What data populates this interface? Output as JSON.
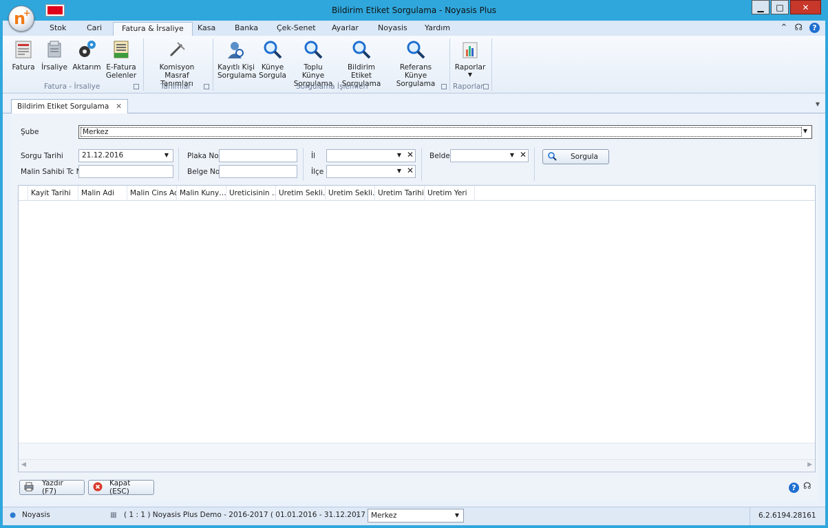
{
  "window": {
    "title": "Bildirim Etiket Sorgulama - Noyasis Plus",
    "minimize_glyph": "▁",
    "maximize_glyph": "□",
    "close_glyph": "✕"
  },
  "menu": {
    "tabs": [
      "Stok",
      "Cari",
      "Fatura & İrsaliye",
      "Kasa",
      "Banka",
      "Çek-Senet",
      "Ayarlar",
      "Noyasis",
      "Yardım"
    ],
    "active_tab": "Fatura & İrsaliye"
  },
  "ribbon": {
    "groups": [
      {
        "label": "Fatura - İrsaliye",
        "buttons": [
          "Fatura",
          "İrsaliye",
          "Aktarım",
          "E-Fatura Gelenler"
        ]
      },
      {
        "label": "Tanımlar",
        "buttons": [
          "Komisyon Masraf Tanımları"
        ]
      },
      {
        "label": "Sorgulama İşlemleri",
        "buttons": [
          "Kayıtlı Kişi Sorgulama",
          "Künye Sorgula",
          "Toplu Künye Sorgulama",
          "Bildirim Etiket Sorgulama",
          "Referans Künye Sorgulama"
        ]
      },
      {
        "label": "Raporlar",
        "buttons": [
          "Raporlar"
        ]
      }
    ]
  },
  "doc_tab": {
    "label": "Bildirim Etiket Sorgulama",
    "close": "✕"
  },
  "form": {
    "sube_label": "Şube",
    "sube_value": "Merkez",
    "sorgu_tarihi_label": "Sorgu Tarihi",
    "sorgu_tarihi_value": "21.12.2016",
    "malin_sahibi_label": "Malin Sahibi Tc No",
    "malin_sahibi_value": "",
    "plaka_label": "Plaka No",
    "plaka_value": "",
    "belge_label": "Belge No",
    "belge_value": "",
    "il_label": "İl",
    "il_value": "",
    "ilce_label": "İlçe",
    "ilce_value": "",
    "belde_label": "Belde",
    "belde_value": "",
    "sorgula_label": "Sorgula"
  },
  "grid": {
    "columns": [
      "Kayit Tarihi",
      "Malin Adi",
      "Malin Cins Adi",
      "Malin Kuny…",
      "Ureticisinin …",
      "Uretim Sekli…",
      "Uretim Sekli…",
      "Uretim Tarihi",
      "Uretim Yeri"
    ]
  },
  "footer_buttons": {
    "print": "Yazdır (F7)",
    "close": "Kapat (ESC)"
  },
  "status": {
    "user": "Noyasis",
    "company": "( 1 : 1 )  Noyasis Plus Demo - 2016-2017  ( 01.01.2016 - 31.12.2017 )",
    "branch": "Merkez",
    "version": "6.2.6194.28161"
  },
  "colors": {
    "accent": "#2fa7dc",
    "flag": "#e1001a",
    "close_button": "#c7372a"
  }
}
